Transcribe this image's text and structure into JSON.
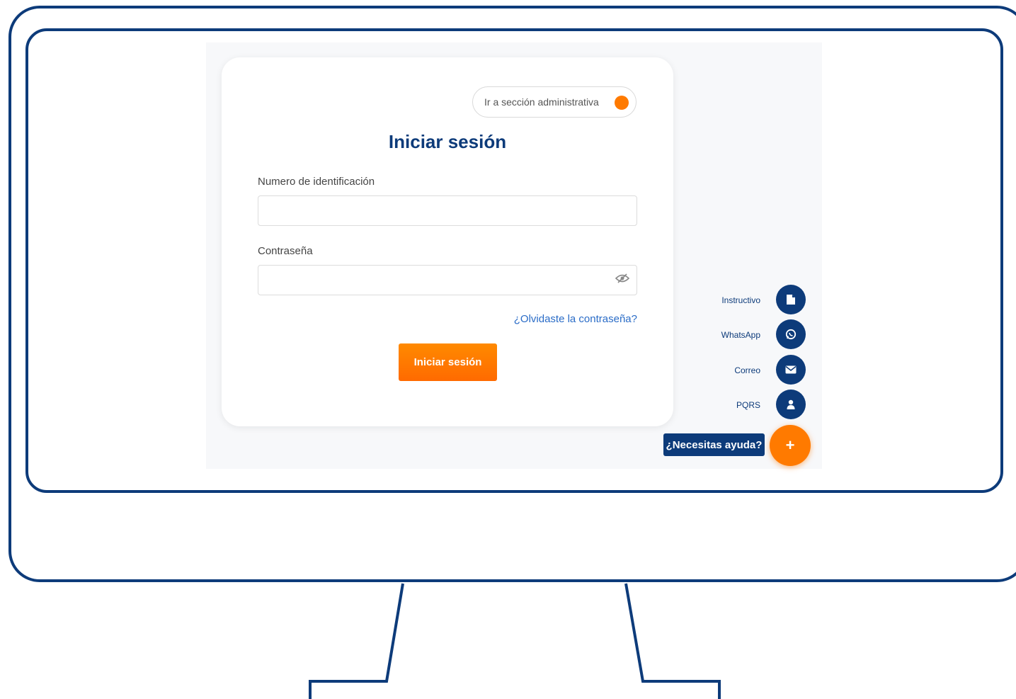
{
  "login": {
    "admin_toggle_label": "Ir a sección administrativa",
    "title": "Iniciar sesión",
    "id_label": "Numero de identificación",
    "id_value": "",
    "password_label": "Contraseña",
    "password_value": "",
    "forgot_link": "¿Olvidaste la contraseña?",
    "submit_label": "Iniciar sesión"
  },
  "help": {
    "items": [
      {
        "label": "Instructivo",
        "icon": "file-icon"
      },
      {
        "label": "WhatsApp",
        "icon": "whatsapp-icon"
      },
      {
        "label": "Correo",
        "icon": "envelope-icon"
      },
      {
        "label": "PQRS",
        "icon": "user-icon"
      }
    ],
    "badge": "¿Necesitas ayuda?",
    "plus": "+"
  },
  "colors": {
    "brand_blue": "#0d3b7a",
    "accent_orange": "#ff7a00",
    "link_blue": "#2a6cc7"
  }
}
